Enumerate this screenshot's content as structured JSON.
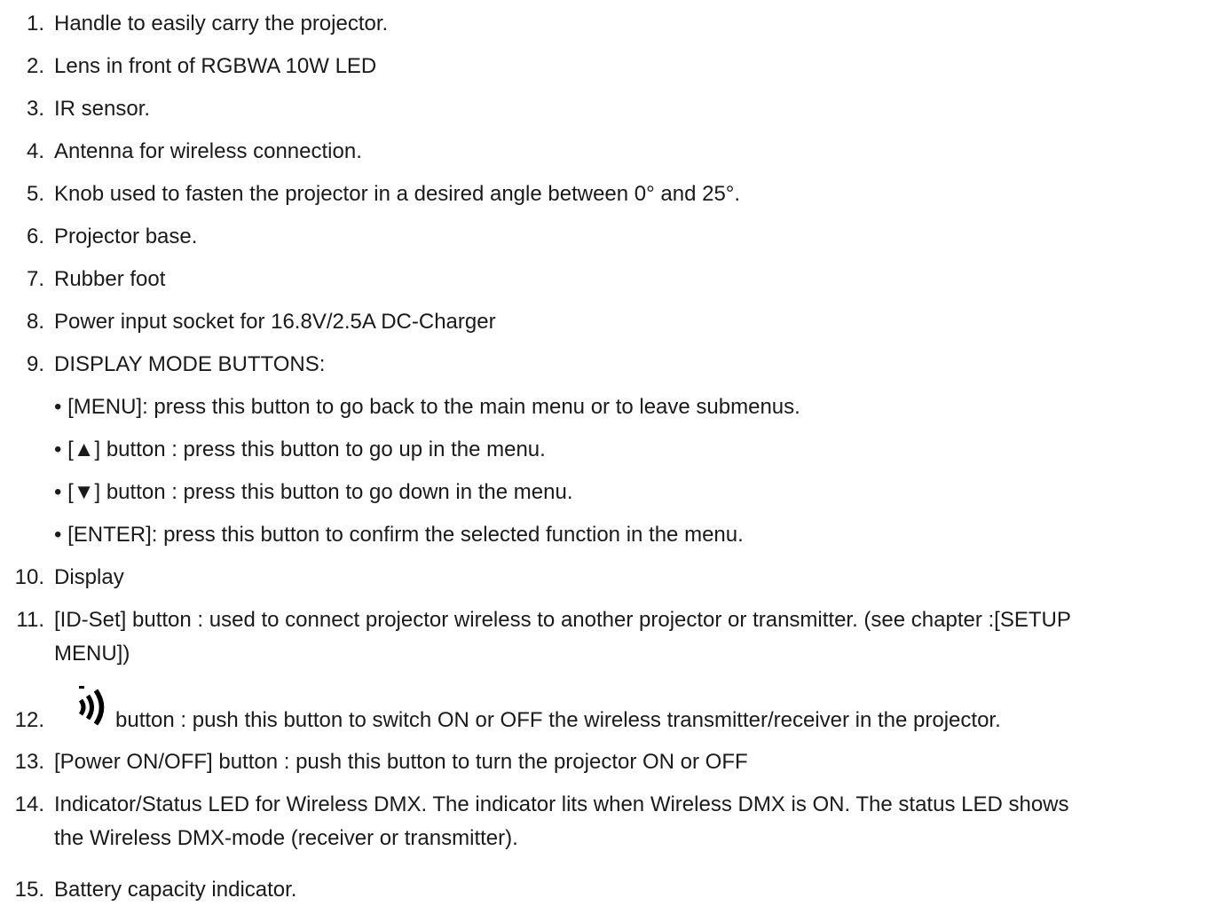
{
  "items": [
    {
      "num": "1.",
      "text": "Handle to easily carry the projector."
    },
    {
      "num": "2.",
      "text": "Lens in front of RGBWA 10W LED"
    },
    {
      "num": "3.",
      "text": "IR sensor."
    },
    {
      "num": "4.",
      "text": "Antenna for wireless connection."
    },
    {
      "num": "5.",
      "text": "Knob used to fasten the projector in a desired angle between 0° and 25°."
    },
    {
      "num": "6.",
      "text": "Projector base."
    },
    {
      "num": "7.",
      "text": "Rubber foot"
    },
    {
      "num": "8.",
      "text": "Power input socket for 16.8V/2.5A DC-Charger"
    },
    {
      "num": "9.",
      "text": "DISPLAY MODE BUTTONS:"
    },
    {
      "num": "10.",
      "text": "Display"
    },
    {
      "num": "11.",
      "text": "[ID-Set] button : used to connect projector wireless to another projector or transmitter. (see chapter :[SETUP",
      "cont": "MENU])"
    },
    {
      "num": "12.",
      "text": "button : push this button to switch ON or OFF the wireless transmitter/receiver in the projector."
    },
    {
      "num": "13.",
      "text": "[Power ON/OFF] button : push this button to turn the projector ON or OFF"
    },
    {
      "num": "14.",
      "text": "Indicator/Status LED for Wireless DMX. The indicator lits when Wireless DMX is ON. The status LED shows",
      "cont": "the Wireless DMX-mode (receiver or transmitter)."
    },
    {
      "num": "15.",
      "text": "Battery capacity indicator."
    }
  ],
  "display_mode_buttons": [
    "• [MENU]: press this button to go back to the main menu or to leave submenus.",
    "• [▲] button : press this button to go up in the menu.",
    "• [▼] button : press this button to go down in the menu.",
    "• [ENTER]: press this button to confirm the selected function in the menu."
  ],
  "icons": {
    "item12": "wireless-signal-icon"
  }
}
